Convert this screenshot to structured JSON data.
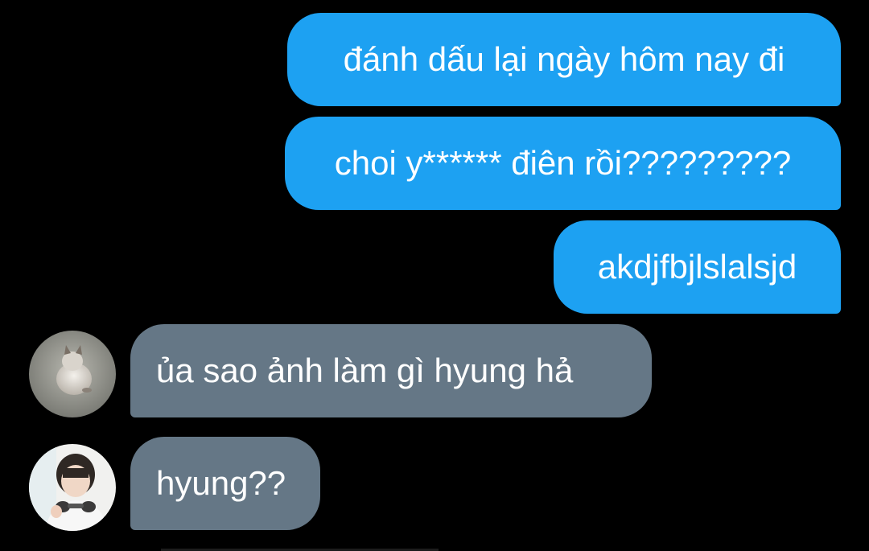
{
  "conversation": {
    "messages": [
      {
        "direction": "sent",
        "text": "đánh dấu lại ngày hôm nay đi"
      },
      {
        "direction": "sent",
        "text": "choi y****** điên rồi?????????"
      },
      {
        "direction": "sent",
        "text": "akdjfbjlslalsjd"
      },
      {
        "direction": "received",
        "text": "ủa sao ảnh làm gì hyung hả",
        "avatar": "cat-avatar"
      },
      {
        "direction": "received",
        "text": "hyung??",
        "avatar": "person-avatar"
      }
    ]
  },
  "colors": {
    "background": "#000000",
    "sent_bubble": "#1da1f2",
    "received_bubble": "#657786",
    "text": "#ffffff"
  }
}
